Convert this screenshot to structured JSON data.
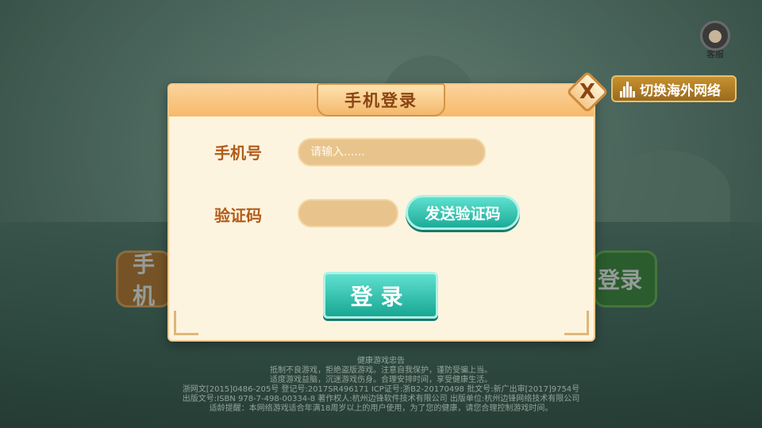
{
  "background": {
    "side_left_label": "手机",
    "side_right_label": "登录",
    "customer_service_label": "客服",
    "network_switch_label": "切换海外网络"
  },
  "dialog": {
    "title": "手机登录",
    "close_symbol": "X",
    "phone_label": "手机号",
    "phone_placeholder": "请输入......",
    "code_label": "验证码",
    "code_value": "",
    "send_code_label": "发送验证码",
    "login_label": "登录"
  },
  "footer": {
    "lines": [
      "健康游戏忠告",
      "抵制不良游戏，拒绝盗版游戏。注意自我保护，谨防受骗上当。",
      "适度游戏益脑，沉迷游戏伤身。合理安排时间，享受健康生活。",
      "浙网文[2015]0486-205号  登记号:2017SR496171  ICP证号:浙B2-20170498  批文号:新广出审[2017]9754号",
      "出版文号:ISBN 978-7-498-00334-8  著作权人:杭州边锋软件技术有限公司  出版单位:杭州边锋网络技术有限公司",
      "适龄提醒：本网络游戏适合年满18周岁以上的用户使用，为了您的健康，请您合理控制游戏时间。"
    ]
  },
  "colors": {
    "accent_teal": "#1bab98",
    "title_brown": "#8a4513",
    "label_brown": "#b25c1a",
    "dialog_bg": "#fdf4df"
  },
  "icons": [
    "customer-service-icon",
    "signal-icon",
    "close-icon"
  ]
}
